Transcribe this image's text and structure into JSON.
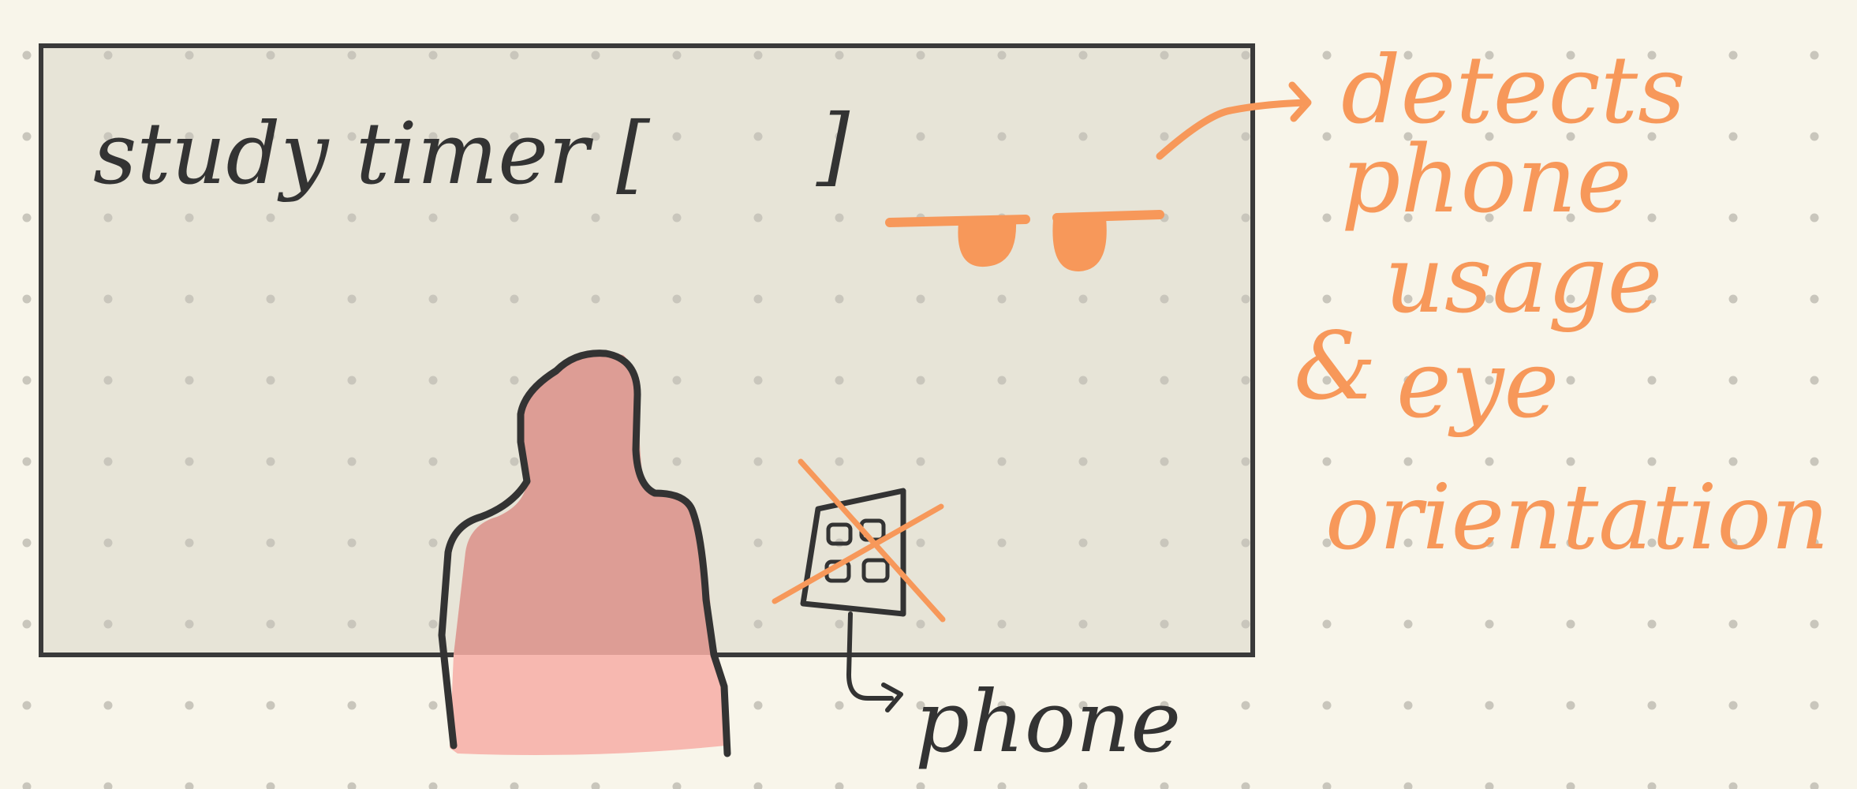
{
  "sketch": {
    "heading_text": "study timer [",
    "heading_bracket_close": "]",
    "phone_label": "phone",
    "annotation_lines": [
      "detects",
      "phone",
      "usage",
      "&",
      "eye",
      "orientation"
    ],
    "colors": {
      "background": "#f8f5ea",
      "grid_dot": "#c9c6bc",
      "frame_fill": "#e6e3d6",
      "frame_stroke": "#3a3a3a",
      "accent_orange": "#f7985a",
      "person_fill": "#f7b8b0",
      "ink": "#333333"
    },
    "icons": {
      "eyes": "eyes-icon",
      "person": "person-silhouette",
      "phone": "phone-icon",
      "cross": "cross-out-mark"
    }
  }
}
